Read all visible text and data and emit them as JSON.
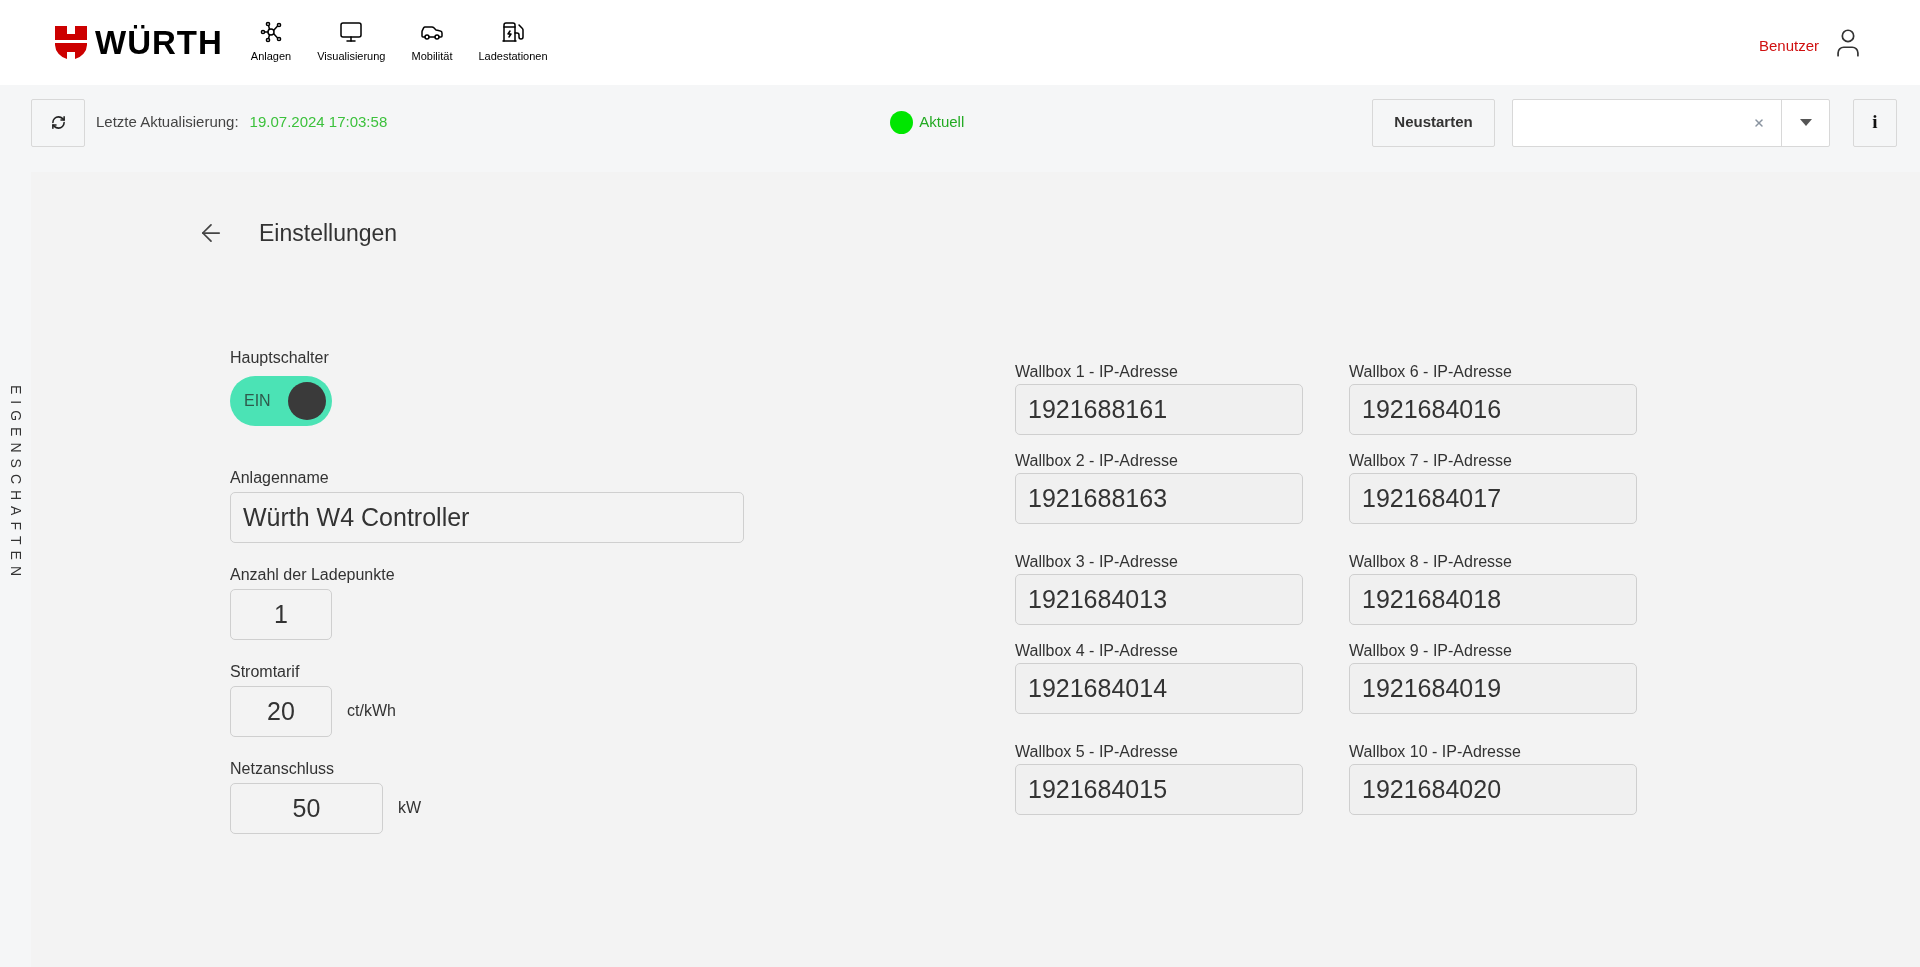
{
  "header": {
    "logo_text": "WÜRTH",
    "nav": [
      {
        "label": "Anlagen",
        "kind": "network"
      },
      {
        "label": "Visualisierung",
        "kind": "monitor"
      },
      {
        "label": "Mobilität",
        "kind": "car"
      },
      {
        "label": "Ladestationen",
        "kind": "charger"
      }
    ],
    "user": "Benutzer"
  },
  "toolbar": {
    "last_update_label": "Letzte Aktualisierung:",
    "last_update": "19.07.2024 17:03:58",
    "status": {
      "label": "Aktuell",
      "color": "#00e600"
    },
    "restart_button": "Neustarten",
    "info_button": "i"
  },
  "side_tab": "EIGENSCHAFTEN",
  "page": {
    "title": "Einstellungen",
    "main_switch": {
      "label": "Hauptschalter",
      "on": true,
      "text": "EIN"
    },
    "fields": [
      {
        "label": "Anlagenname",
        "value": "Würth W4 Controller",
        "kind": "wide"
      },
      {
        "label": "Anzahl der Ladepunkte",
        "value": "1",
        "kind": "small"
      },
      {
        "label": "Stromtarif",
        "value": "20",
        "unit": "ct/kWh",
        "kind": "small"
      },
      {
        "label": "Netzanschluss",
        "value": "50",
        "unit": "kW",
        "kind": "medium"
      }
    ],
    "wallboxes": [
      {
        "label": "Wallbox 1 - IP-Adresse",
        "value": "1921688161"
      },
      {
        "label": "Wallbox 2 - IP-Adresse",
        "value": "1921688163"
      },
      {
        "label": "Wallbox 3 - IP-Adresse",
        "value": "1921684013"
      },
      {
        "label": "Wallbox 4 - IP-Adresse",
        "value": "1921684014"
      },
      {
        "label": "Wallbox 5 - IP-Adresse",
        "value": "1921684015"
      },
      {
        "label": "Wallbox 6 - IP-Adresse",
        "value": "1921684016"
      },
      {
        "label": "Wallbox 7 - IP-Adresse",
        "value": "1921684017"
      },
      {
        "label": "Wallbox 8 - IP-Adresse",
        "value": "1921684018"
      },
      {
        "label": "Wallbox 9 - IP-Adresse",
        "value": "1921684019"
      },
      {
        "label": "Wallbox 10 - IP-Adresse",
        "value": "1921684020"
      }
    ]
  }
}
